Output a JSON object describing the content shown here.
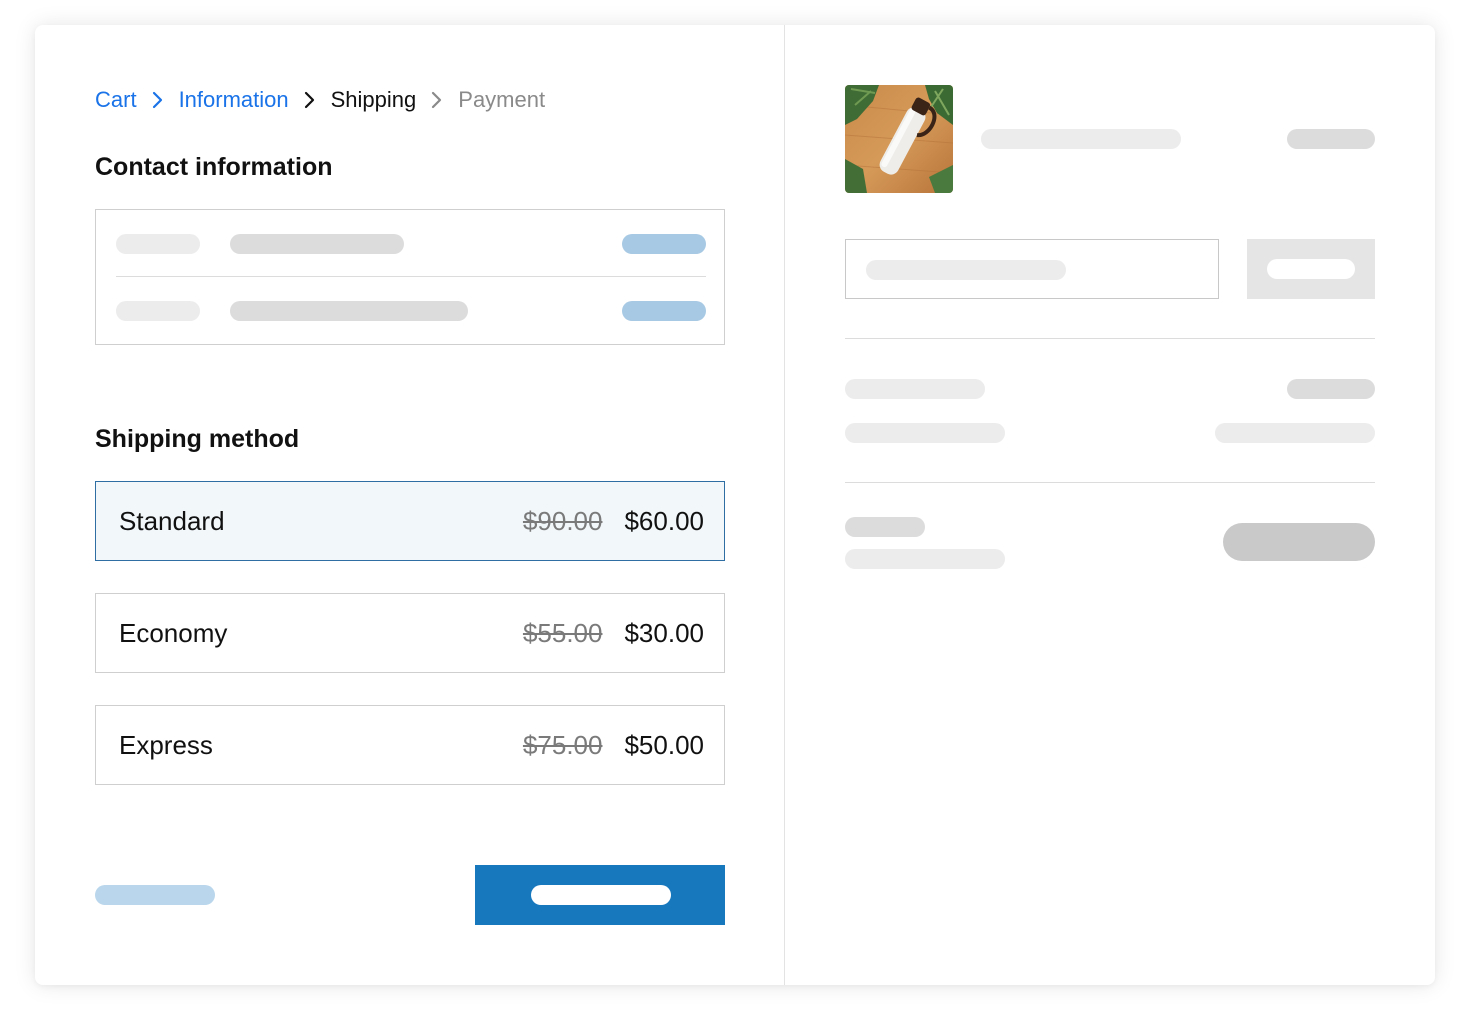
{
  "breadcrumb": {
    "steps": [
      {
        "label": "Cart",
        "state": "link"
      },
      {
        "label": "Information",
        "state": "link"
      },
      {
        "label": "Shipping",
        "state": "current"
      },
      {
        "label": "Payment",
        "state": "future"
      }
    ],
    "separator_icon": "chevron-right-icon"
  },
  "contact": {
    "title": "Contact information"
  },
  "shipping": {
    "title": "Shipping method",
    "options": [
      {
        "name": "Standard",
        "old_price": "$90.00",
        "price": "$60.00",
        "selected": true
      },
      {
        "name": "Economy",
        "old_price": "$55.00",
        "price": "$30.00",
        "selected": false
      },
      {
        "name": "Express",
        "old_price": "$75.00",
        "price": "$50.00",
        "selected": false
      }
    ]
  },
  "summary": {
    "product_image": "water-bottle-product-image"
  },
  "colors": {
    "link": "#1a73e8",
    "primary_button": "#1878be",
    "selected_border": "#2f6ea3",
    "selected_bg": "#f2f7fa",
    "placeholder_blue": "#a7c9e4"
  }
}
